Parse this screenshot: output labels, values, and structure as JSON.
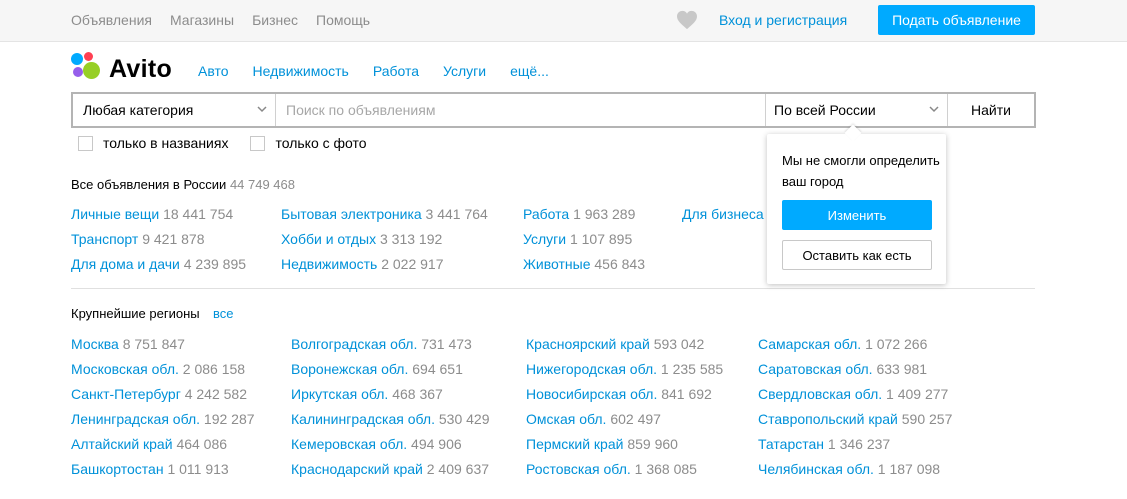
{
  "top_nav": [
    "Объявления",
    "Магазины",
    "Бизнес",
    "Помощь"
  ],
  "header": {
    "login": "Вход и регистрация",
    "post_ad": "Подать объявление",
    "favorites_icon": "heart-icon"
  },
  "logo": {
    "text": "Avito",
    "dot_colors": [
      "#965eeb",
      "#ff4053",
      "#0af",
      "#97cf26"
    ]
  },
  "main_nav": [
    "Авто",
    "Недвижимость",
    "Работа",
    "Услуги",
    "ещё..."
  ],
  "search": {
    "category": "Любая категория",
    "placeholder": "Поиск по объявлениям",
    "region": "По всей России",
    "find": "Найти"
  },
  "filters": [
    "только в названиях",
    "только с фото"
  ],
  "all_listings": {
    "title": "Все объявления в России",
    "count": "44 749 468"
  },
  "categories": [
    [
      {
        "name": "Личные вещи",
        "count": "18 441 754"
      },
      {
        "name": "Транспорт",
        "count": "9 421 878"
      },
      {
        "name": "Для дома и дачи",
        "count": "4 239 895"
      }
    ],
    [
      {
        "name": "Бытовая электроника",
        "count": "3 441 764"
      },
      {
        "name": "Хобби и отдых",
        "count": "3 313 192"
      },
      {
        "name": "Недвижимость",
        "count": "2 022 917"
      }
    ],
    [
      {
        "name": "Работа",
        "count": "1 963 289"
      },
      {
        "name": "Услуги",
        "count": "1 107 895"
      },
      {
        "name": "Животные",
        "count": "456 843"
      }
    ],
    [
      {
        "name": "Для бизнеса",
        "count": ""
      }
    ]
  ],
  "regions_title": "Крупнейшие регионы",
  "regions_all": "все",
  "regions": [
    [
      {
        "name": "Москва",
        "count": "8 751 847"
      },
      {
        "name": "Московская обл.",
        "count": "2 086 158"
      },
      {
        "name": "Санкт-Петербург",
        "count": "4 242 582"
      },
      {
        "name": "Ленинградская обл.",
        "count": "192 287"
      },
      {
        "name": "Алтайский край",
        "count": "464 086"
      },
      {
        "name": "Башкортостан",
        "count": "1 011 913"
      }
    ],
    [
      {
        "name": "Волгоградская обл.",
        "count": "731 473"
      },
      {
        "name": "Воронежская обл.",
        "count": "694 651"
      },
      {
        "name": "Иркутская обл.",
        "count": "468 367"
      },
      {
        "name": "Калининградская обл.",
        "count": "530 429"
      },
      {
        "name": "Кемеровская обл.",
        "count": "494 906"
      },
      {
        "name": "Краснодарский край",
        "count": "2 409 637"
      }
    ],
    [
      {
        "name": "Красноярский край",
        "count": "593 042"
      },
      {
        "name": "Нижегородская обл.",
        "count": "1 235 585"
      },
      {
        "name": "Новосибирская обл.",
        "count": "841 692"
      },
      {
        "name": "Омская обл.",
        "count": "602 497"
      },
      {
        "name": "Пермский край",
        "count": "859 960"
      },
      {
        "name": "Ростовская обл.",
        "count": "1 368 085"
      }
    ],
    [
      {
        "name": "Самарская обл.",
        "count": "1 072 266"
      },
      {
        "name": "Саратовская обл.",
        "count": "633 981"
      },
      {
        "name": "Свердловская обл.",
        "count": "1 409 277"
      },
      {
        "name": "Ставропольский край",
        "count": "590 257"
      },
      {
        "name": "Татарстан",
        "count": "1 346 237"
      },
      {
        "name": "Челябинская обл.",
        "count": "1 187 098"
      }
    ]
  ],
  "city_popup": {
    "message": "Мы не смогли определить ваш город",
    "change": "Изменить",
    "keep": "Оставить как есть"
  }
}
